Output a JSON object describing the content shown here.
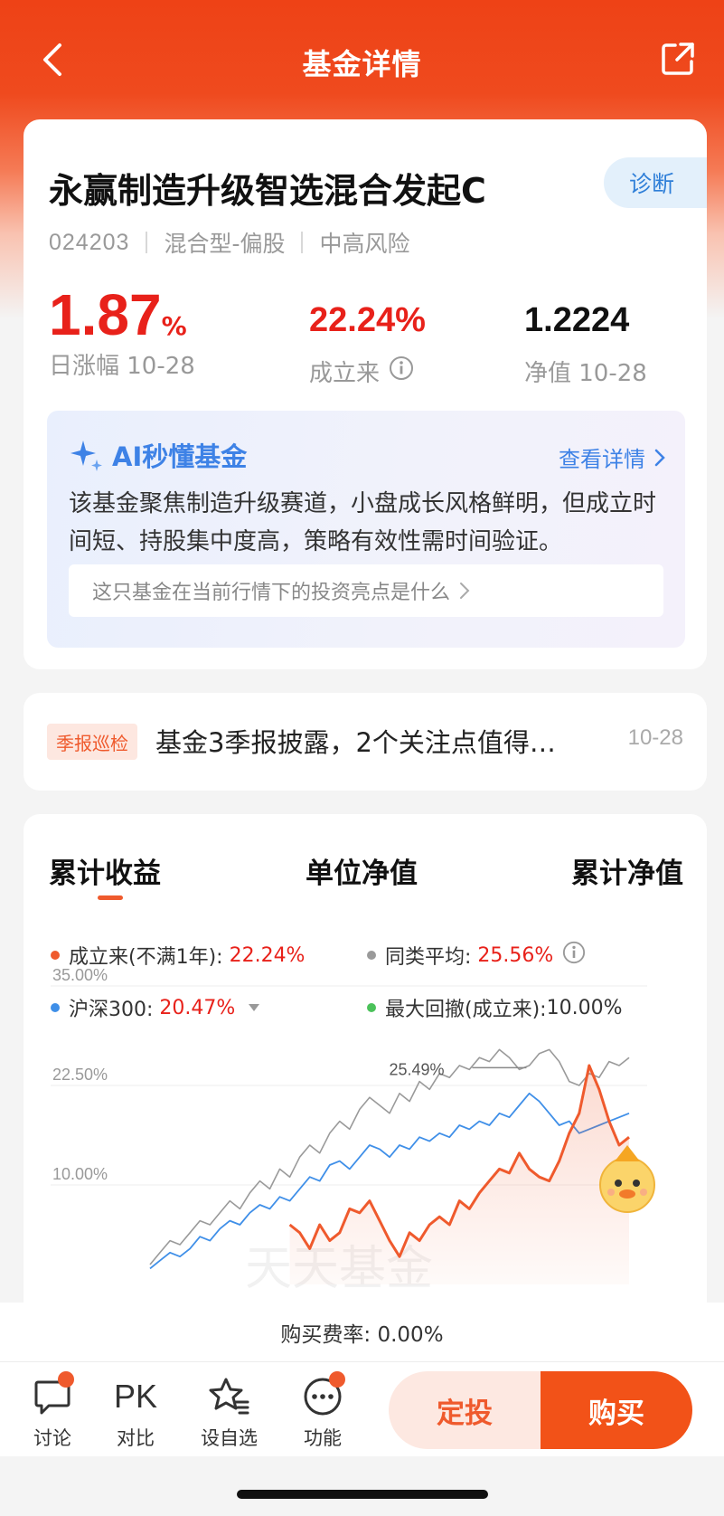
{
  "header": {
    "title": "基金详情"
  },
  "fund": {
    "name": "永赢制造升级智选混合发起C",
    "diagnose_label": "诊断",
    "code": "024203",
    "type": "混合型-偏股",
    "risk": "中高风险",
    "daily_change_value": "1.87",
    "daily_change_unit": "%",
    "daily_change_label": "日涨幅 10-28",
    "since_inception_value": "22.24%",
    "since_inception_label": "成立来",
    "nav_value": "1.2224",
    "nav_label": "净值 10-28"
  },
  "ai": {
    "title": "AI秒懂基金",
    "more_label": "查看详情",
    "summary": "该基金聚焦制造升级赛道，小盘成长风格鲜明，但成立时间短、持股集中度高，策略有效性需时间验证。",
    "question": "这只基金在当前行情下的投资亮点是什么"
  },
  "notice": {
    "tag": "季报巡检",
    "text": "基金3季报披露，2个关注点值得…",
    "date": "10-28"
  },
  "chart_tabs": [
    "累计收益",
    "单位净值",
    "累计净值"
  ],
  "legend": {
    "fund_label": "成立来(不满1年):",
    "fund_value": "22.24%",
    "peer_label": "同类平均:",
    "peer_value": "25.56%",
    "hs300_label": "沪深300:",
    "hs300_value": "20.47%",
    "drawdown_label": "最大回撤(成立来):",
    "drawdown_value": "10.00%"
  },
  "colors": {
    "fund": "#ef5a2d",
    "peer": "#9a9a9a",
    "hs300": "#3f8fe8",
    "drawdown": "#4bc25a",
    "brand": "#ee4216"
  },
  "chart_data": {
    "type": "line",
    "yticks": [
      "35.00%",
      "22.50%",
      "10.00%"
    ],
    "ylim": [
      -2.5,
      35
    ],
    "peak_label": "25.49%",
    "series": [
      {
        "name": "同类平均",
        "values": [
          0,
          1.5,
          3,
          2.5,
          4,
          5.5,
          5,
          6.5,
          8,
          7,
          9,
          10.5,
          9.5,
          12,
          11,
          13.5,
          15,
          14,
          16.5,
          18,
          17,
          19.5,
          21,
          20,
          19,
          21.5,
          20.5,
          23,
          22,
          24,
          23.5,
          25,
          24.5,
          26,
          25.5,
          27,
          26,
          24.5,
          25,
          26.5,
          27,
          25.5,
          23,
          22.5,
          24,
          23.5,
          25.5,
          25,
          26
        ]
      },
      {
        "name": "沪深300",
        "values": [
          -0.5,
          0.5,
          1.5,
          1,
          2,
          3.5,
          3,
          4.5,
          5.5,
          5,
          6.5,
          7.5,
          7,
          8.5,
          8,
          9.5,
          11,
          10.5,
          12.5,
          13,
          12,
          13.5,
          15,
          14.5,
          13.5,
          15,
          14.5,
          16,
          15.5,
          16.5,
          16,
          17.5,
          17,
          18,
          17.5,
          19,
          18.5,
          20,
          21.5,
          20.5,
          19,
          17.5,
          18,
          16.5,
          17,
          17.5,
          18,
          18.5,
          19
        ]
      },
      {
        "name": "成立来",
        "values": [
          null,
          null,
          null,
          null,
          null,
          null,
          null,
          null,
          null,
          null,
          null,
          null,
          null,
          null,
          5,
          4,
          2,
          5,
          3,
          4,
          7,
          6.5,
          8,
          5.5,
          3,
          1,
          4,
          3,
          5,
          6,
          5,
          8,
          7,
          9,
          10.5,
          12,
          11.5,
          14,
          12,
          11,
          10.5,
          13,
          16.5,
          19,
          25,
          22,
          18,
          15,
          16
        ]
      }
    ]
  },
  "fee": {
    "text": "购买费率: 0.00%"
  },
  "bottom": {
    "discuss": "讨论",
    "pk": "PK",
    "compare": "对比",
    "watch": "设自选",
    "functions": "功能",
    "dingtou": "定投",
    "buy": "购买"
  }
}
